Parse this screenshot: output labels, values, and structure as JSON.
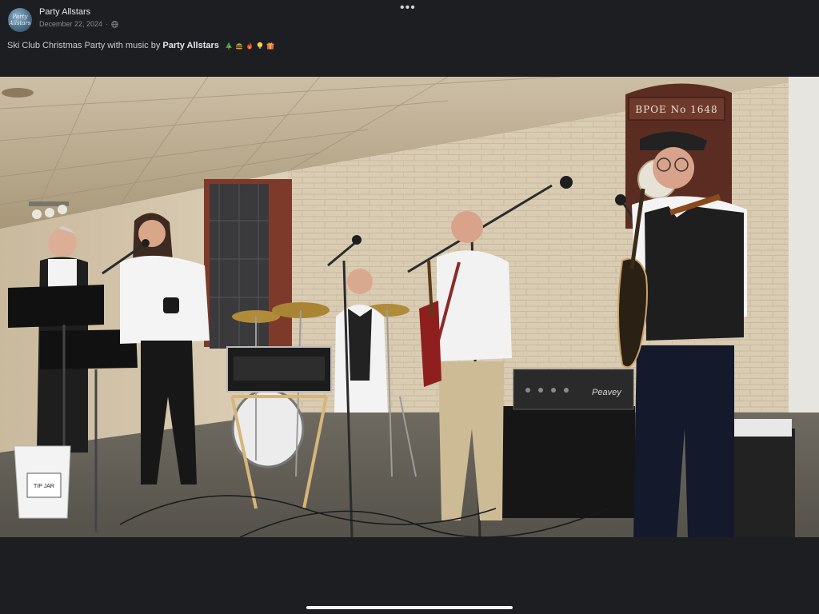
{
  "post": {
    "author": "Party Allstars",
    "avatar_text": "Party Allstars",
    "date": "December 22, 2024",
    "visibility_icon": "globe-icon",
    "more_icon": "•••",
    "caption_prefix": "Ski Club Christmas Party with music by",
    "caption_mention": "Party Allstars",
    "caption_emojis": [
      "christmas-tree-emoji",
      "hamburger-emoji",
      "fire-emoji",
      "lightbulb-emoji",
      "gift-emoji"
    ]
  },
  "photo": {
    "sign_text": "BPOE No 1648",
    "amp_brand": "Peavey",
    "bucket_label": "TIP JAR"
  },
  "colors": {
    "background": "#1c1e22",
    "text_primary": "#e4e6eb",
    "text_secondary": "#8a8d91"
  }
}
